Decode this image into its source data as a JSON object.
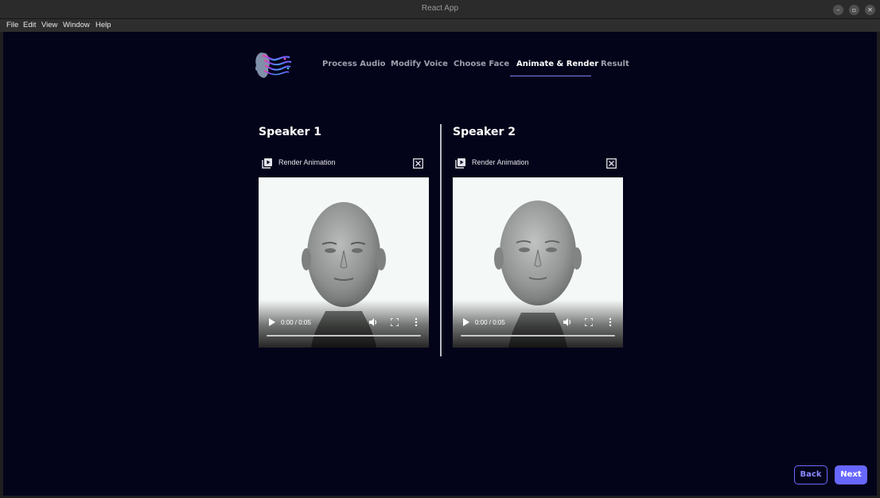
{
  "window": {
    "title": "React App"
  },
  "menu": [
    "File",
    "Edit",
    "View",
    "Window",
    "Help"
  ],
  "nav": {
    "steps": [
      "Process Audio",
      "Modify Voice",
      "Choose Face",
      "Animate & Render",
      "Result"
    ],
    "active_index": 3
  },
  "speakers": [
    {
      "title": "Speaker 1",
      "render_label": "Render Animation",
      "time": "0:00 / 0:05"
    },
    {
      "title": "Speaker 2",
      "render_label": "Render Animation",
      "time": "0:00 / 0:05"
    }
  ],
  "footer": {
    "back_label": "Back",
    "next_label": "Next"
  },
  "colors": {
    "background": "#03031a",
    "accent": "#6767ff"
  },
  "icons": [
    "minimize-icon",
    "maximize-icon",
    "close-icon",
    "logo-icon",
    "render-play-icon",
    "close-box-icon",
    "play-icon",
    "volume-icon",
    "fullscreen-icon",
    "more-icon"
  ]
}
